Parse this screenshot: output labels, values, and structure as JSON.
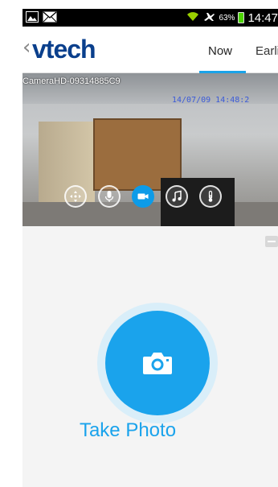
{
  "status_bar": {
    "battery_pct": "63%",
    "time": "14:47"
  },
  "header": {
    "logo": "vtech",
    "tabs": [
      {
        "label": "Now",
        "active": true
      },
      {
        "label": "Earlie",
        "active": false
      }
    ]
  },
  "camera": {
    "name": "CameraHD-09314885C9",
    "timestamp": "14/07/09 14:48:2",
    "controls": [
      {
        "icon": "move-arrows-icon",
        "active": false
      },
      {
        "icon": "microphone-icon",
        "active": false
      },
      {
        "icon": "video-camera-icon",
        "active": true
      },
      {
        "icon": "music-note-icon",
        "active": false
      },
      {
        "icon": "thermometer-icon",
        "active": false
      }
    ]
  },
  "photo": {
    "label": "Take Photo"
  },
  "colors": {
    "accent": "#1aa3ec",
    "logo": "#0a3f8c",
    "battery": "#4cd400"
  }
}
